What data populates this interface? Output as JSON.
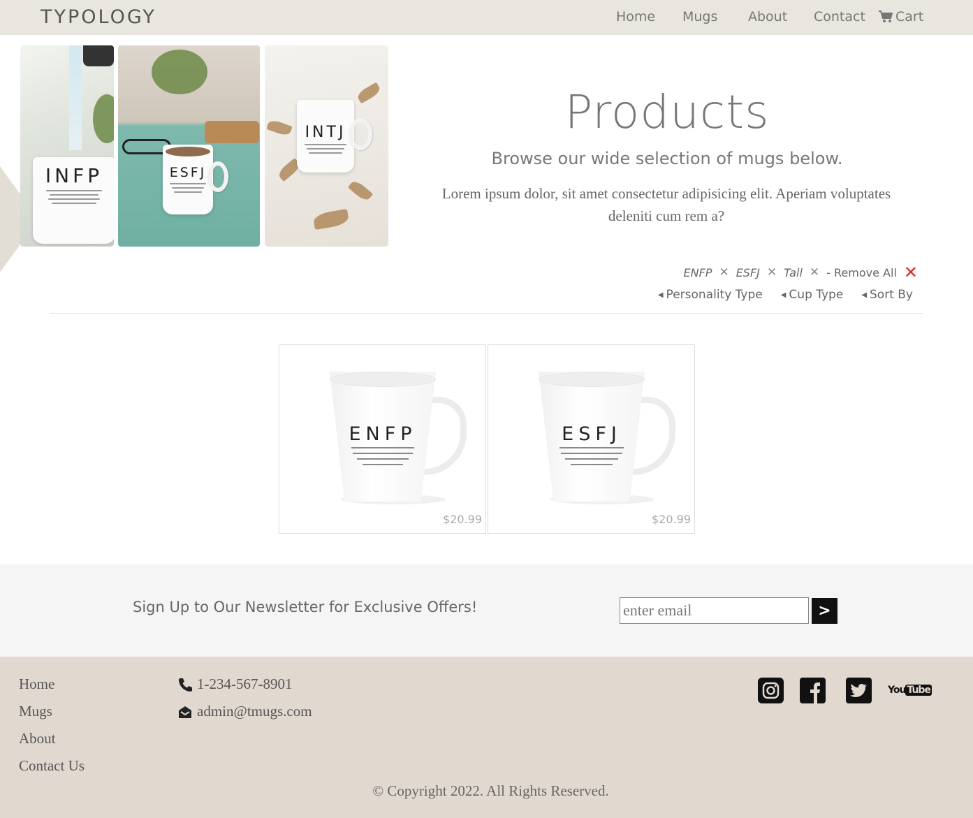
{
  "navbar": {
    "brand": "TYPOLOGY",
    "links": [
      "Home",
      "Mugs",
      "About",
      "Contact"
    ],
    "cart_label": "Cart"
  },
  "hero": {
    "images": [
      {
        "mug_text": "INFP"
      },
      {
        "mug_text": "ESFJ"
      },
      {
        "mug_text": "INTJ"
      }
    ],
    "title": "Products",
    "subtitle": "Browse our wide selection of mugs below.",
    "body": "Lorem ipsum dolor, sit amet consectetur adipisicing elit. Aperiam voluptates deleniti cum rem a?"
  },
  "filters": {
    "active": [
      "ENFP",
      "ESFJ",
      "Tall"
    ],
    "remove_all_label": "- Remove All",
    "dropdowns": [
      "Personality Type",
      "Cup Type",
      "Sort By"
    ]
  },
  "products": [
    {
      "mug_text": "ENFP",
      "price": "$20.99"
    },
    {
      "mug_text": "ESFJ",
      "price": "$20.99"
    }
  ],
  "newsletter": {
    "text": "Sign Up to Our Newsletter for Exclusive Offers!",
    "placeholder": "enter email",
    "submit_label": ">"
  },
  "footer": {
    "links": [
      "Home",
      "Mugs",
      "About",
      "Contact Us"
    ],
    "phone": "1-234-567-8901",
    "email": "admin@tmugs.com",
    "social": [
      "instagram-icon",
      "facebook-icon",
      "twitter-icon",
      "youtube-icon"
    ],
    "youtube_you": "You",
    "youtube_tube": "Tube",
    "copyright": "© Copyright 2022. All Rights Reserved."
  },
  "colors": {
    "navbar_bg": "#e9e6e0",
    "footer_bg": "#e1d9d0",
    "remove_x": "#e02424"
  }
}
